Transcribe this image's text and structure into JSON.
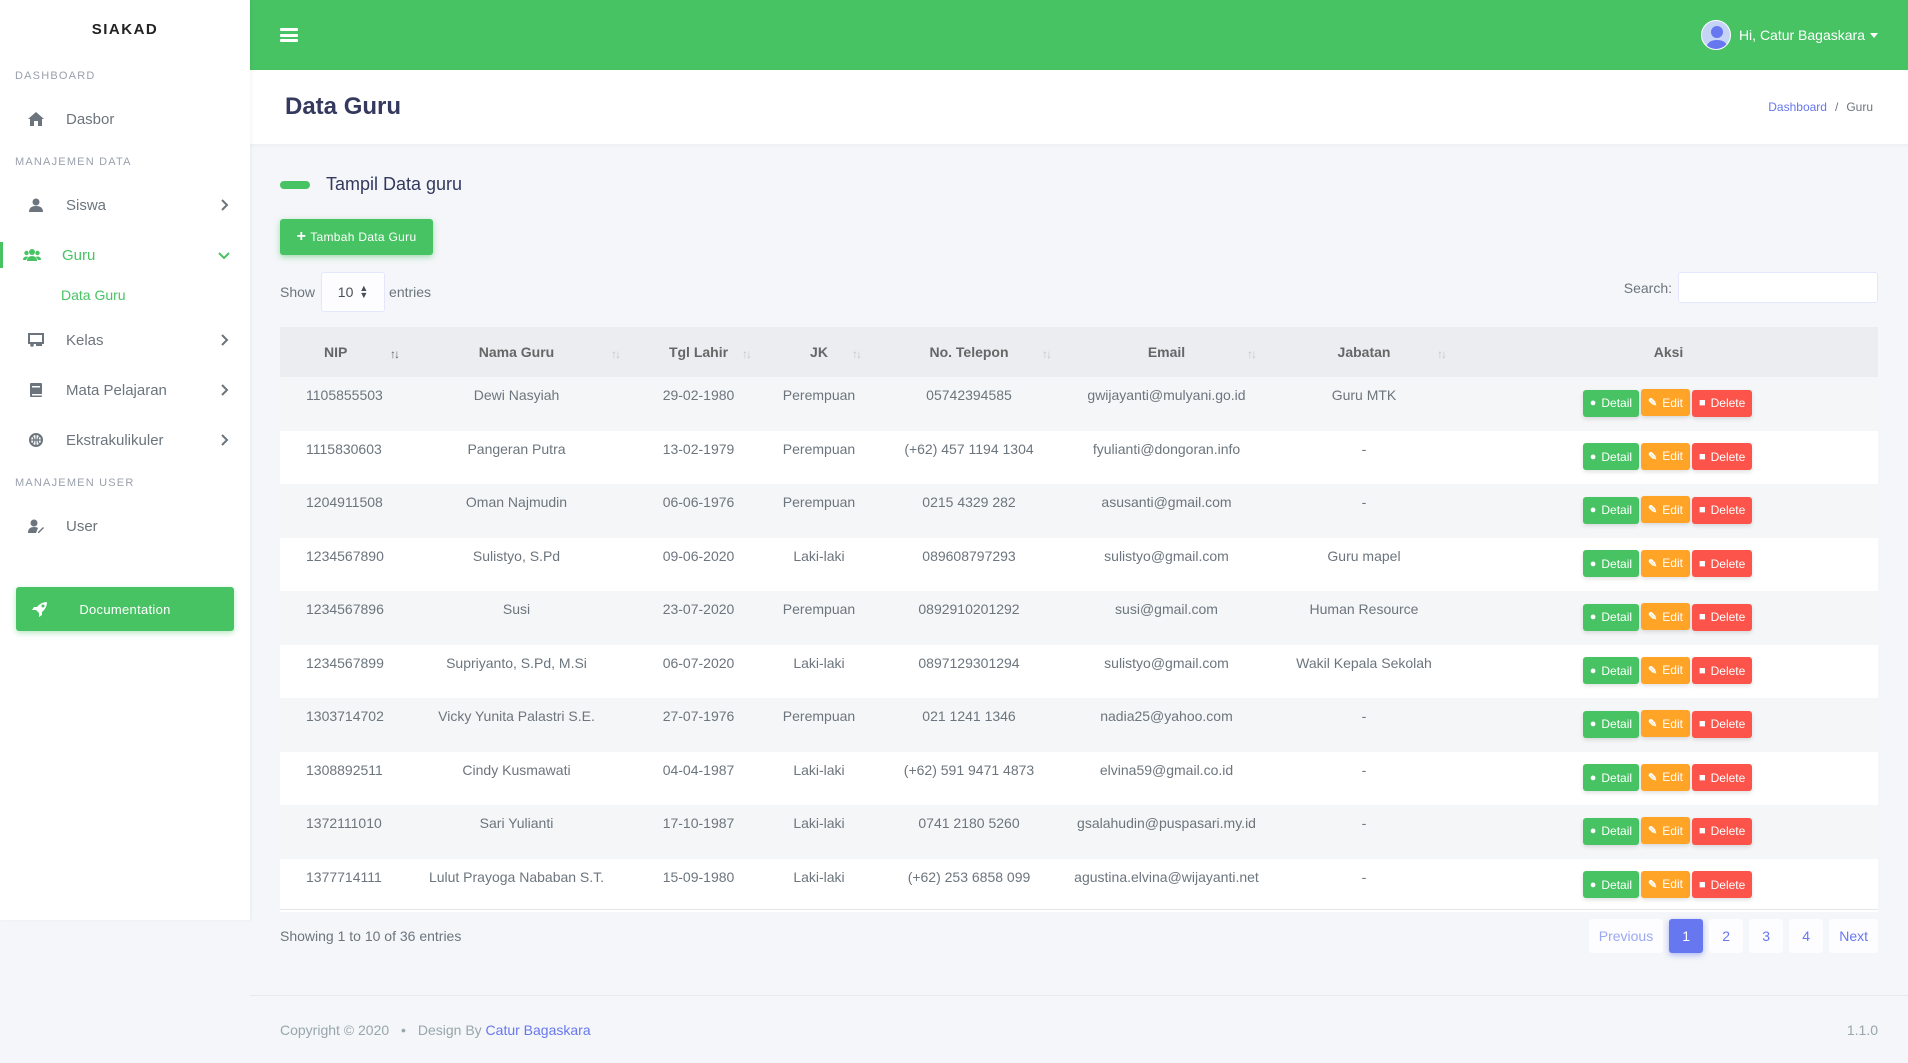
{
  "sidebar": {
    "brand": "SIAKAD",
    "headings": {
      "dashboard": "DASHBOARD",
      "data": "MANAJEMEN DATA",
      "user": "MANAJEMEN USER"
    },
    "items": {
      "dasbor": "Dasbor",
      "siswa": "Siswa",
      "guru": "Guru",
      "data_guru": "Data Guru",
      "kelas": "Kelas",
      "mapel": "Mata Pelajaran",
      "ekskul": "Ekstrakulikuler",
      "user": "User"
    },
    "documentation": "Documentation"
  },
  "navbar": {
    "greeting": "Hi, Catur Bagaskara"
  },
  "header": {
    "title": "Data Guru",
    "breadcrumb": {
      "home": "Dashboard",
      "current": "Guru"
    }
  },
  "card": {
    "title": "Tampil Data guru",
    "add_button": "Tambah Data Guru"
  },
  "length": {
    "show": "Show",
    "value": "10",
    "entries": "entries"
  },
  "search": {
    "label": "Search:"
  },
  "table": {
    "headers": [
      "NIP",
      "Nama Guru",
      "Tgl Lahir",
      "JK",
      "No. Telepon",
      "Email",
      "Jabatan",
      "Aksi"
    ],
    "rows": [
      [
        "1105855503",
        "Dewi Nasyiah",
        "29-02-1980",
        "Perempuan",
        "05742394585",
        "gwijayanti@mulyani.go.id",
        "Guru MTK"
      ],
      [
        "1115830603",
        "Pangeran Putra",
        "13-02-1979",
        "Perempuan",
        "(+62) 457 1194 1304",
        "fyulianti@dongoran.info",
        "-"
      ],
      [
        "1204911508",
        "Oman Najmudin",
        "06-06-1976",
        "Perempuan",
        "0215 4329 282",
        "asusanti@gmail.com",
        "-"
      ],
      [
        "1234567890",
        "Sulistyo, S.Pd",
        "09-06-2020",
        "Laki-laki",
        "089608797293",
        "sulistyo@gmail.com",
        "Guru mapel"
      ],
      [
        "1234567896",
        "Susi",
        "23-07-2020",
        "Perempuan",
        "0892910201292",
        "susi@gmail.com",
        "Human Resource"
      ],
      [
        "1234567899",
        "Supriyanto, S.Pd, M.Si",
        "06-07-2020",
        "Laki-laki",
        "0897129301294",
        "sulistyo@gmail.com",
        "Wakil Kepala Sekolah"
      ],
      [
        "1303714702",
        "Vicky Yunita Palastri S.E.",
        "27-07-1976",
        "Perempuan",
        "021 1241 1346",
        "nadia25@yahoo.com",
        "-"
      ],
      [
        "1308892511",
        "Cindy Kusmawati",
        "04-04-1987",
        "Laki-laki",
        "(+62) 591 9471 4873",
        "elvina59@gmail.co.id",
        "-"
      ],
      [
        "1372111010",
        "Sari Yulianti",
        "17-10-1987",
        "Laki-laki",
        "0741 2180 5260",
        "gsalahudin@puspasari.my.id",
        "-"
      ],
      [
        "1377714111",
        "Lulut Prayoga Nababan S.T.",
        "15-09-1980",
        "Laki-laki",
        "(+62) 253 6858 099",
        "agustina.elvina@wijayanti.net",
        "-"
      ]
    ],
    "actions": {
      "detail": "Detail",
      "edit": "Edit",
      "delete": "Delete"
    }
  },
  "info": "Showing 1 to 10 of 36 entries",
  "pagination": {
    "previous": "Previous",
    "pages": [
      "1",
      "2",
      "3",
      "4"
    ],
    "next": "Next"
  },
  "footer": {
    "copyright": "Copyright © 2020",
    "design_by": "Design By",
    "author": "Catur Bagaskara",
    "version": "1.1.0"
  },
  "colors": {
    "primary_green": "#47c363",
    "accent_blue": "#6777ef",
    "warning": "#ffa426",
    "danger": "#fc544b"
  }
}
